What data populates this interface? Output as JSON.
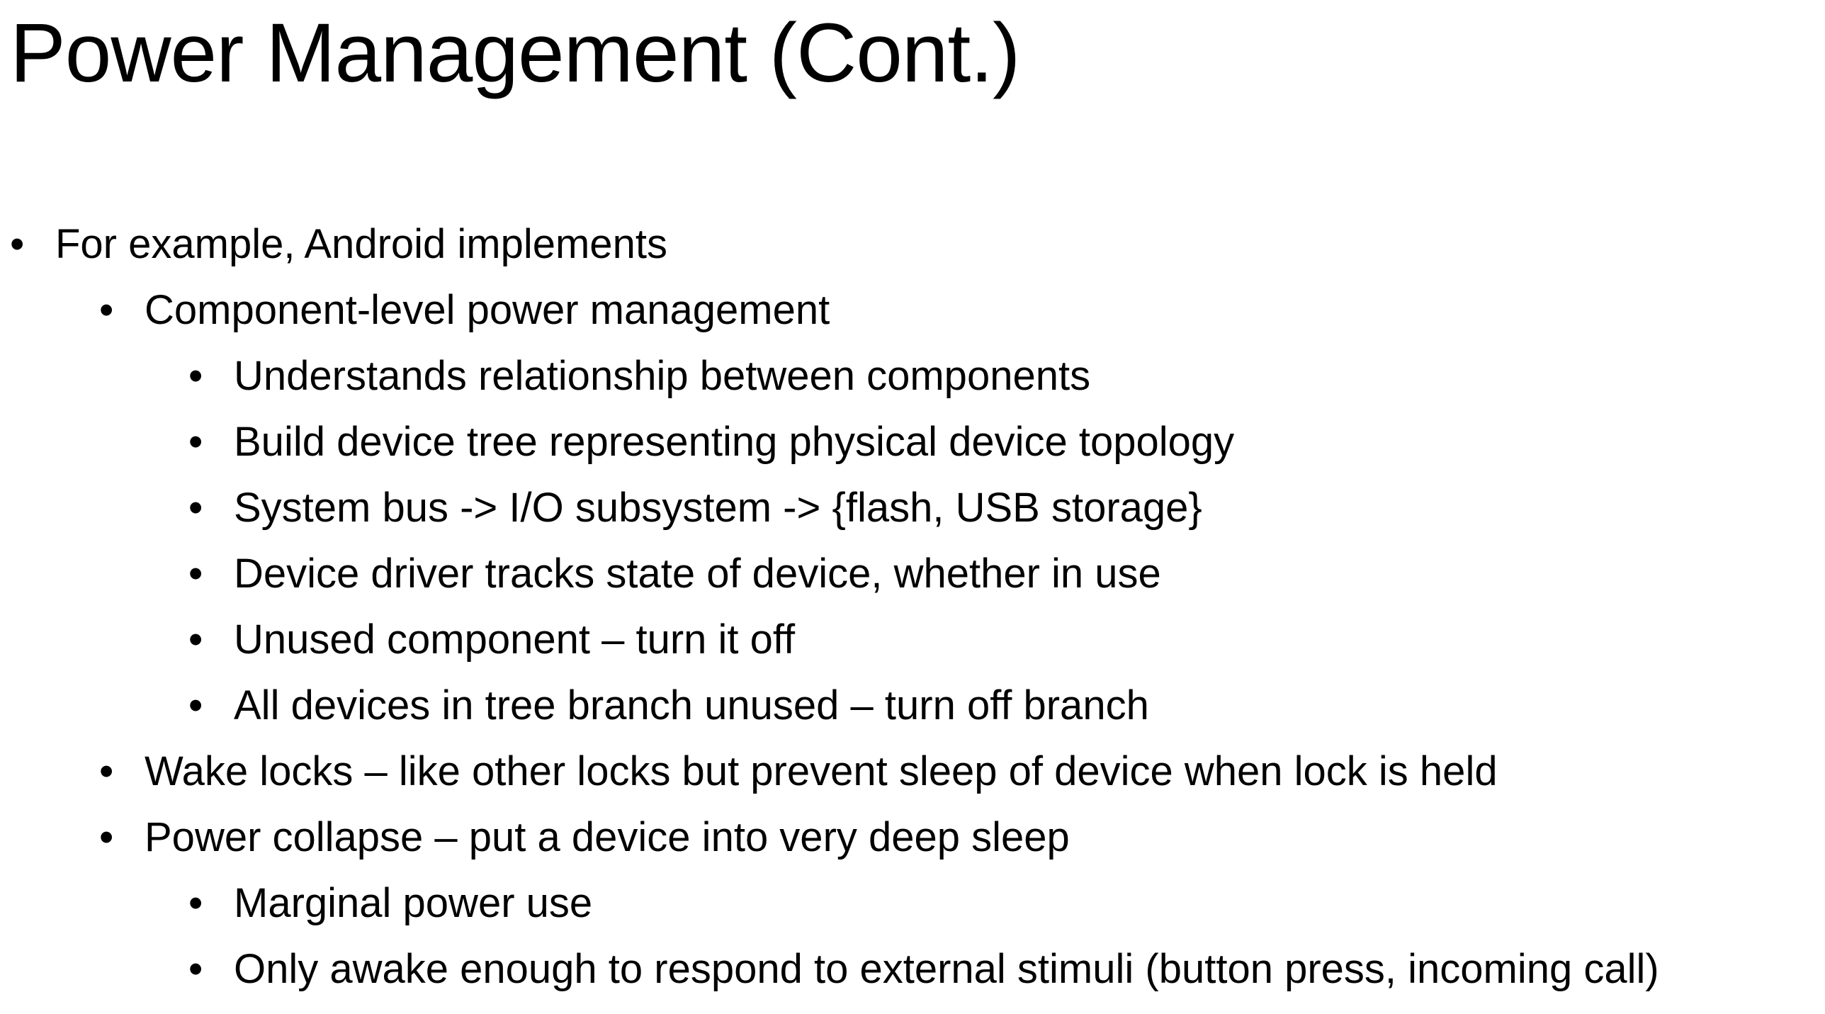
{
  "slide": {
    "title": "Power Management (Cont.)",
    "bullet_glyph": "•",
    "bullets": [
      {
        "level": 1,
        "text": "For example, Android implements"
      },
      {
        "level": 2,
        "text": "Component-level power management"
      },
      {
        "level": 3,
        "text": "Understands relationship between components"
      },
      {
        "level": 3,
        "text": "Build device tree representing physical device topology"
      },
      {
        "level": 3,
        "text": "System bus -> I/O subsystem -> {flash, USB storage}"
      },
      {
        "level": 3,
        "text": "Device driver tracks state of device, whether in use"
      },
      {
        "level": 3,
        "text": "Unused component – turn it off"
      },
      {
        "level": 3,
        "text": "All devices in tree branch unused – turn off branch"
      },
      {
        "level": 2,
        "text": "Wake locks – like other locks but prevent sleep of device when lock is held"
      },
      {
        "level": 2,
        "text": "Power collapse – put a device into very deep sleep"
      },
      {
        "level": 3,
        "text": "Marginal power use"
      },
      {
        "level": 3,
        "text": "Only awake enough to respond to external stimuli (button press, incoming call)"
      }
    ]
  }
}
